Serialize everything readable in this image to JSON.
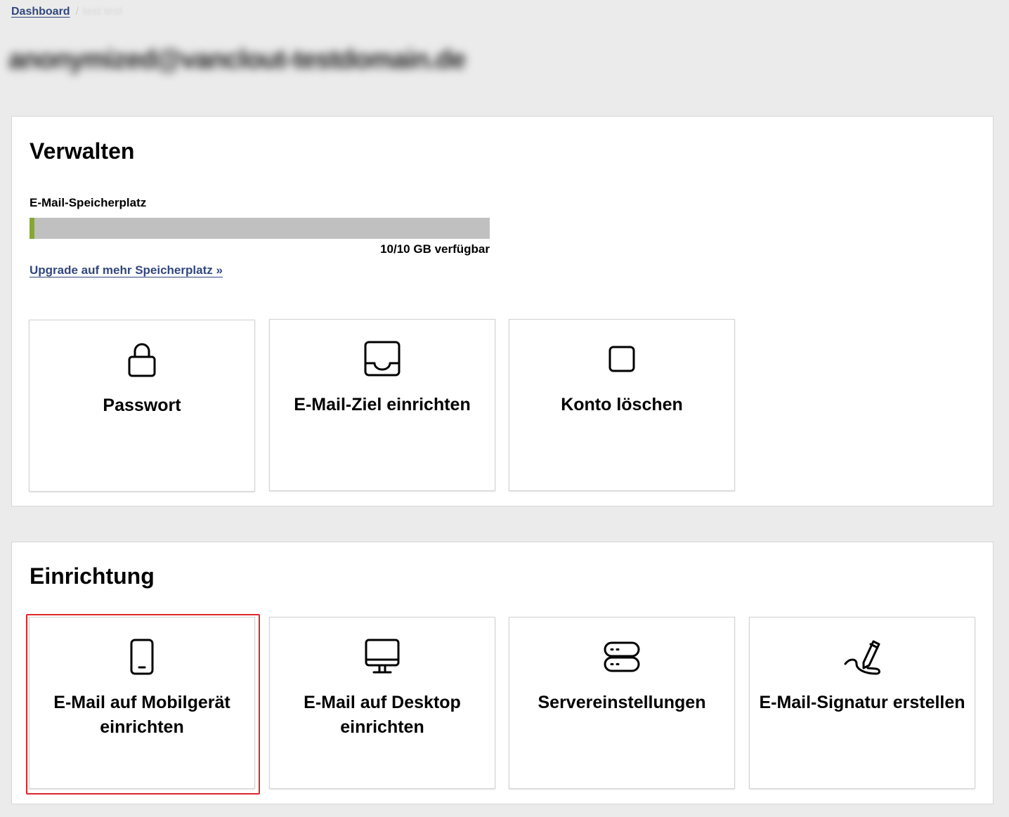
{
  "breadcrumb": {
    "home": "Dashboard",
    "separator": "/",
    "current": "test test"
  },
  "account": {
    "title": "anonymized@vanclout-testdomain.de"
  },
  "manage": {
    "heading": "Verwalten",
    "storage_label": "E-Mail-Speicherplatz",
    "storage_used_fraction": 0.011,
    "storage_available": "10/10 GB verfügbar",
    "upgrade_link": "Upgrade auf mehr Speicherplatz »",
    "tiles": [
      {
        "label": "Passwort",
        "icon": "lock-icon"
      },
      {
        "label": "E-Mail-Ziel einrichten",
        "icon": "inbox-icon"
      },
      {
        "label": "Konto löschen",
        "icon": "square-icon"
      }
    ]
  },
  "setup": {
    "heading": "Einrichtung",
    "tiles": [
      {
        "label": "E-Mail auf Mobilgerät einrichten",
        "icon": "smartphone-icon"
      },
      {
        "label": "E-Mail auf Desktop einrichten",
        "icon": "monitor-icon"
      },
      {
        "label": "Servereinstellungen",
        "icon": "server-icon"
      },
      {
        "label": "E-Mail-Signatur erstellen",
        "icon": "signature-icon"
      }
    ]
  },
  "colors": {
    "link": "#32477d",
    "storage_bar": "#c0c0c0",
    "storage_fill": "#86a830",
    "highlight": "#e0262a",
    "background": "#ebebeb"
  }
}
